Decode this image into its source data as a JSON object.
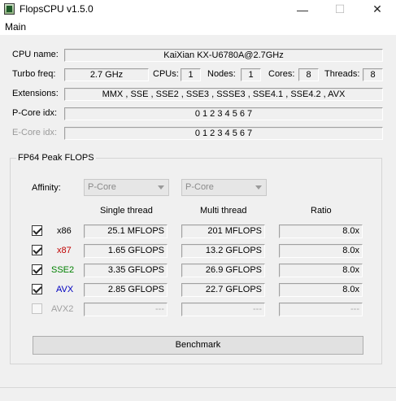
{
  "window": {
    "title": "FlopsCPU v1.5.0",
    "minimize_glyph": "—",
    "maximize_glyph": "☐",
    "close_glyph": "✕"
  },
  "menu": {
    "main": "Main"
  },
  "cpu": {
    "name_label": "CPU name:",
    "name_value": "KaiXian KX-U6780A@2.7GHz",
    "turbo_label": "Turbo freq:",
    "turbo_value": "2.7 GHz",
    "cpus_label": "CPUs:",
    "cpus_value": "1",
    "nodes_label": "Nodes:",
    "nodes_value": "1",
    "cores_label": "Cores:",
    "cores_value": "8",
    "threads_label": "Threads:",
    "threads_value": "8",
    "extensions_label": "Extensions:",
    "extensions_value": "MMX , SSE , SSE2 , SSE3 , SSSE3 , SSE4.1 , SSE4.2 , AVX",
    "pcore_label": "P-Core idx:",
    "pcore_value": "0 1 2 3 4 5 6 7",
    "ecore_label": "E-Core idx:",
    "ecore_value": "0 1 2 3 4 5 6 7"
  },
  "peak": {
    "group_title": "FP64 Peak FLOPS",
    "affinity_label": "Affinity:",
    "affinity_single": "P-Core",
    "affinity_multi": "P-Core",
    "col_single": "Single thread",
    "col_multi": "Multi thread",
    "col_ratio": "Ratio",
    "rows": [
      {
        "name": "x86",
        "color": "#000000",
        "checked": true,
        "single": "25.1 MFLOPS",
        "multi": "201 MFLOPS",
        "ratio": "8.0x"
      },
      {
        "name": "x87",
        "color": "#c00000",
        "checked": true,
        "single": "1.65 GFLOPS",
        "multi": "13.2 GFLOPS",
        "ratio": "8.0x"
      },
      {
        "name": "SSE2",
        "color": "#008000",
        "checked": true,
        "single": "3.35 GFLOPS",
        "multi": "26.9 GFLOPS",
        "ratio": "8.0x"
      },
      {
        "name": "AVX",
        "color": "#0000c0",
        "checked": true,
        "single": "2.85 GFLOPS",
        "multi": "22.7 GFLOPS",
        "ratio": "8.0x"
      },
      {
        "name": "AVX2",
        "color": "#a0a0a0",
        "checked": false,
        "single": "---",
        "multi": "---",
        "ratio": "---"
      }
    ],
    "benchmark_label": "Benchmark"
  }
}
